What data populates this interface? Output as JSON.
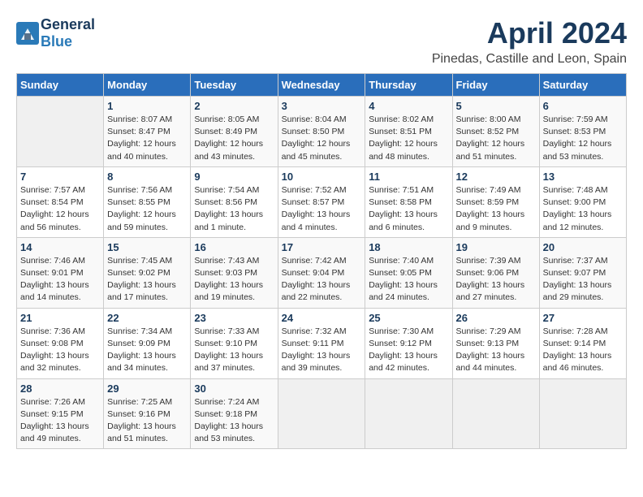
{
  "header": {
    "logo_general": "General",
    "logo_blue": "Blue",
    "title": "April 2024",
    "subtitle": "Pinedas, Castille and Leon, Spain"
  },
  "days_of_week": [
    "Sunday",
    "Monday",
    "Tuesday",
    "Wednesday",
    "Thursday",
    "Friday",
    "Saturday"
  ],
  "weeks": [
    [
      {
        "day": "",
        "info": ""
      },
      {
        "day": "1",
        "info": "Sunrise: 8:07 AM\nSunset: 8:47 PM\nDaylight: 12 hours\nand 40 minutes."
      },
      {
        "day": "2",
        "info": "Sunrise: 8:05 AM\nSunset: 8:49 PM\nDaylight: 12 hours\nand 43 minutes."
      },
      {
        "day": "3",
        "info": "Sunrise: 8:04 AM\nSunset: 8:50 PM\nDaylight: 12 hours\nand 45 minutes."
      },
      {
        "day": "4",
        "info": "Sunrise: 8:02 AM\nSunset: 8:51 PM\nDaylight: 12 hours\nand 48 minutes."
      },
      {
        "day": "5",
        "info": "Sunrise: 8:00 AM\nSunset: 8:52 PM\nDaylight: 12 hours\nand 51 minutes."
      },
      {
        "day": "6",
        "info": "Sunrise: 7:59 AM\nSunset: 8:53 PM\nDaylight: 12 hours\nand 53 minutes."
      }
    ],
    [
      {
        "day": "7",
        "info": "Sunrise: 7:57 AM\nSunset: 8:54 PM\nDaylight: 12 hours\nand 56 minutes."
      },
      {
        "day": "8",
        "info": "Sunrise: 7:56 AM\nSunset: 8:55 PM\nDaylight: 12 hours\nand 59 minutes."
      },
      {
        "day": "9",
        "info": "Sunrise: 7:54 AM\nSunset: 8:56 PM\nDaylight: 13 hours\nand 1 minute."
      },
      {
        "day": "10",
        "info": "Sunrise: 7:52 AM\nSunset: 8:57 PM\nDaylight: 13 hours\nand 4 minutes."
      },
      {
        "day": "11",
        "info": "Sunrise: 7:51 AM\nSunset: 8:58 PM\nDaylight: 13 hours\nand 6 minutes."
      },
      {
        "day": "12",
        "info": "Sunrise: 7:49 AM\nSunset: 8:59 PM\nDaylight: 13 hours\nand 9 minutes."
      },
      {
        "day": "13",
        "info": "Sunrise: 7:48 AM\nSunset: 9:00 PM\nDaylight: 13 hours\nand 12 minutes."
      }
    ],
    [
      {
        "day": "14",
        "info": "Sunrise: 7:46 AM\nSunset: 9:01 PM\nDaylight: 13 hours\nand 14 minutes."
      },
      {
        "day": "15",
        "info": "Sunrise: 7:45 AM\nSunset: 9:02 PM\nDaylight: 13 hours\nand 17 minutes."
      },
      {
        "day": "16",
        "info": "Sunrise: 7:43 AM\nSunset: 9:03 PM\nDaylight: 13 hours\nand 19 minutes."
      },
      {
        "day": "17",
        "info": "Sunrise: 7:42 AM\nSunset: 9:04 PM\nDaylight: 13 hours\nand 22 minutes."
      },
      {
        "day": "18",
        "info": "Sunrise: 7:40 AM\nSunset: 9:05 PM\nDaylight: 13 hours\nand 24 minutes."
      },
      {
        "day": "19",
        "info": "Sunrise: 7:39 AM\nSunset: 9:06 PM\nDaylight: 13 hours\nand 27 minutes."
      },
      {
        "day": "20",
        "info": "Sunrise: 7:37 AM\nSunset: 9:07 PM\nDaylight: 13 hours\nand 29 minutes."
      }
    ],
    [
      {
        "day": "21",
        "info": "Sunrise: 7:36 AM\nSunset: 9:08 PM\nDaylight: 13 hours\nand 32 minutes."
      },
      {
        "day": "22",
        "info": "Sunrise: 7:34 AM\nSunset: 9:09 PM\nDaylight: 13 hours\nand 34 minutes."
      },
      {
        "day": "23",
        "info": "Sunrise: 7:33 AM\nSunset: 9:10 PM\nDaylight: 13 hours\nand 37 minutes."
      },
      {
        "day": "24",
        "info": "Sunrise: 7:32 AM\nSunset: 9:11 PM\nDaylight: 13 hours\nand 39 minutes."
      },
      {
        "day": "25",
        "info": "Sunrise: 7:30 AM\nSunset: 9:12 PM\nDaylight: 13 hours\nand 42 minutes."
      },
      {
        "day": "26",
        "info": "Sunrise: 7:29 AM\nSunset: 9:13 PM\nDaylight: 13 hours\nand 44 minutes."
      },
      {
        "day": "27",
        "info": "Sunrise: 7:28 AM\nSunset: 9:14 PM\nDaylight: 13 hours\nand 46 minutes."
      }
    ],
    [
      {
        "day": "28",
        "info": "Sunrise: 7:26 AM\nSunset: 9:15 PM\nDaylight: 13 hours\nand 49 minutes."
      },
      {
        "day": "29",
        "info": "Sunrise: 7:25 AM\nSunset: 9:16 PM\nDaylight: 13 hours\nand 51 minutes."
      },
      {
        "day": "30",
        "info": "Sunrise: 7:24 AM\nSunset: 9:18 PM\nDaylight: 13 hours\nand 53 minutes."
      },
      {
        "day": "",
        "info": ""
      },
      {
        "day": "",
        "info": ""
      },
      {
        "day": "",
        "info": ""
      },
      {
        "day": "",
        "info": ""
      }
    ]
  ]
}
